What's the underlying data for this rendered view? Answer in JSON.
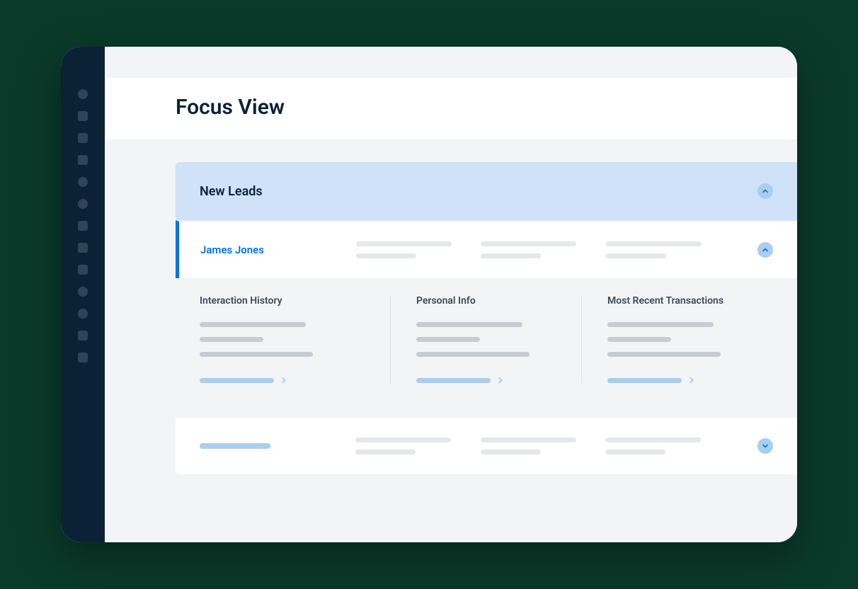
{
  "page": {
    "title": "Focus View"
  },
  "section": {
    "header_label": "New Leads"
  },
  "lead": {
    "name": "James Jones"
  },
  "details": {
    "col1_title": "Interaction History",
    "col2_title": "Personal Info",
    "col3_title": "Most Recent Transactions"
  },
  "colors": {
    "accent": "#0073e6",
    "accent_light": "#cfe2f7",
    "sidebar_bg": "#0b2236"
  }
}
